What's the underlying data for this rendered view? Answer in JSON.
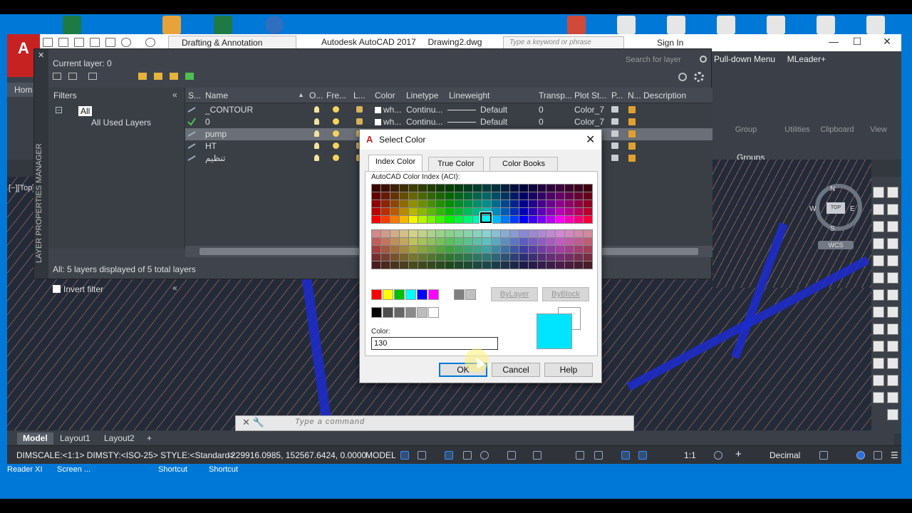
{
  "window": {
    "app_title": "Autodesk AutoCAD 2017",
    "file_name": "Drawing2.dwg",
    "workspace": "Drafting & Annotation",
    "search_placeholder": "Type a keyword or phrase",
    "sign_in": "Sign In"
  },
  "ribbon": {
    "home_tab": "Hom",
    "right_items": [
      "Pull-down Menu",
      "MLeader+"
    ],
    "groups_label": "Groups",
    "panel_buttons": [
      "Group",
      "Utilities",
      "Clipboard",
      "View"
    ]
  },
  "layer_manager": {
    "vertical_label": "LAYER PROPERTIES MANAGER",
    "current_layer": "Current layer: 0",
    "search_placeholder": "Search for layer",
    "filters_header": "Filters",
    "filter_all": "All",
    "filter_used": "All Used Layers",
    "invert_filter": "Invert filter",
    "status": "All: 5 layers displayed of 5 total layers",
    "columns": [
      "S...",
      "Name",
      "O...",
      "Fre...",
      "L...",
      "Color",
      "Linetype",
      "Lineweight",
      "Transp...",
      "Plot St...",
      "P...",
      "N...",
      "Description"
    ],
    "rows": [
      {
        "name": "_CONTOUR",
        "color": "wh...",
        "linetype": "Continu...",
        "lineweight": "Default",
        "transparency": "0",
        "plot_style": "Color_7",
        "current": false,
        "selected": false
      },
      {
        "name": "0",
        "color": "wh...",
        "linetype": "Continu...",
        "lineweight": "Default",
        "transparency": "0",
        "plot_style": "Color_7",
        "current": true,
        "selected": false
      },
      {
        "name": "pump",
        "color": "",
        "linetype": "",
        "lineweight": "",
        "transparency": "",
        "plot_style": "",
        "current": false,
        "selected": true
      },
      {
        "name": "HT",
        "color": "",
        "linetype": "",
        "lineweight": "",
        "transparency": "",
        "plot_style": "",
        "current": false,
        "selected": false
      },
      {
        "name": "تنظيم",
        "color": "",
        "linetype": "",
        "lineweight": "",
        "transparency": "",
        "plot_style": "",
        "current": false,
        "selected": false
      }
    ]
  },
  "select_color": {
    "title": "Select Color",
    "tabs": [
      "Index Color",
      "True Color",
      "Color Books"
    ],
    "active_tab": 0,
    "aci_label": "AutoCAD Color Index (ACI):",
    "bylayer": "ByLayer",
    "byblock": "ByBlock",
    "color_label": "Color:",
    "color_value": "130",
    "ok": "OK",
    "cancel": "Cancel",
    "help": "Help",
    "new_color": "#00e5ff",
    "standard_colors": [
      "#ff0000",
      "#ffff00",
      "#00c000",
      "#00ffff",
      "#0000ff",
      "#ff00ff"
    ],
    "gray_colors": [
      "#000000",
      "#4d4d4d",
      "#666666",
      "#8a8a8a",
      "#bdbdbd",
      "#ffffff"
    ],
    "gray_colors_2": [
      "#808080",
      "#c0c0c0"
    ]
  },
  "drawing": {
    "view_label": "[−][Top]",
    "viewcube_top": "TOP",
    "compass": [
      "N",
      "W",
      "E",
      "S"
    ],
    "wcs": "WCS",
    "contour_color": "#e88c80",
    "road_color": "#1c2ccf"
  },
  "command_line": {
    "placeholder": "Type a command"
  },
  "layout_tabs": [
    "Model",
    "Layout1",
    "Layout2"
  ],
  "status_bar": {
    "dim_info": "DIMSCALE:<1:1> DIMSTY:<ISO-25> STYLE:<Standard>",
    "coordinates": "-229916.0985, 152567.6424, 0.0000",
    "model": "MODEL",
    "scale": "1:1",
    "units": "Decimal"
  },
  "desktop": {
    "labels": [
      "Reader XI",
      "Screen ...",
      "Shortcut",
      "Shortcut"
    ]
  }
}
